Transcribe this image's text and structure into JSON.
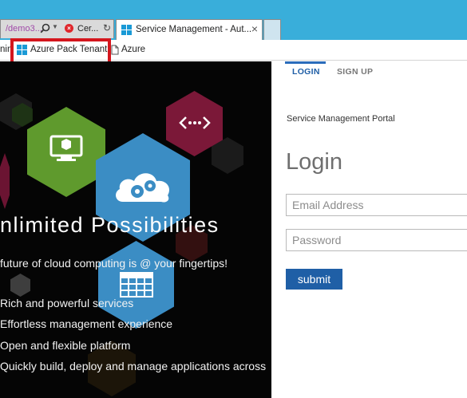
{
  "browser": {
    "address_tab": {
      "url_fragment": "/demo3...",
      "cert_label": "Cer..."
    },
    "active_tab": {
      "title": "Service Management - Aut..."
    },
    "favorites": [
      {
        "label": "nin"
      },
      {
        "label": "Azure Pack Tenant",
        "icon": "windows-logo-icon"
      },
      {
        "label": "Azure",
        "icon": "page-icon"
      }
    ]
  },
  "hero": {
    "title": "nlimited Possibilities",
    "subtitle": "future of cloud computing is @ your fingertips!",
    "features": [
      "Rich and powerful services",
      "Effortless management experience",
      "Open and flexible platform",
      "Quickly build, deploy and manage applications across"
    ],
    "icons": [
      "monitor-box-icon",
      "cloud-gears-icon",
      "code-connection-icon",
      "table-grid-icon"
    ]
  },
  "panel": {
    "tabs": [
      "LOGIN",
      "SIGN UP"
    ],
    "portal_name": "Service Management Portal",
    "heading": "Login",
    "email_placeholder": "Email Address",
    "password_placeholder": "Password",
    "submit_label": "submit"
  },
  "colors": {
    "titlebar": "#39aeda",
    "highlight": "#d4161d",
    "accent_blue": "#1f5fa6",
    "hex_green": "#5f9a2d",
    "hex_blue": "#3b8dc4",
    "hex_maroon": "#7b1838"
  }
}
